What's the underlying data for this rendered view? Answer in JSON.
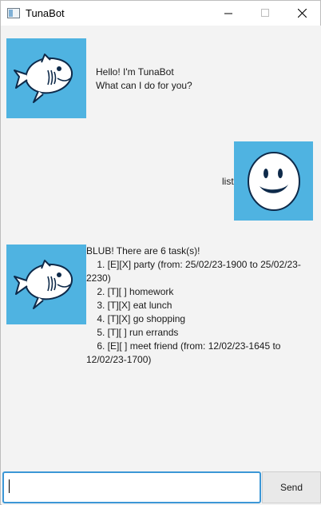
{
  "window": {
    "title": "TunaBot"
  },
  "colors": {
    "avatar_bg": "#4fb3e1",
    "input_border": "#3c97d6"
  },
  "chat": {
    "messages": [
      {
        "sender": "bot",
        "avatar": "fish-icon",
        "text": "Hello! I'm TunaBot\nWhat can I do for you?"
      },
      {
        "sender": "user",
        "avatar": "smiley-face-icon",
        "text": "list"
      },
      {
        "sender": "bot",
        "avatar": "fish-icon",
        "text": "BLUB! There are 6 task(s)!\n    1. [E][X] party (from: 25/02/23-1900 to 25/02/23-2230)\n    2. [T][ ] homework\n    3. [T][X] eat lunch\n    4. [T][X] go shopping\n    5. [T][ ] run errands\n    6. [E][ ] meet friend (from: 12/02/23-1645 to 12/02/23-1700)"
      }
    ]
  },
  "input": {
    "value": "",
    "send_label": "Send"
  }
}
